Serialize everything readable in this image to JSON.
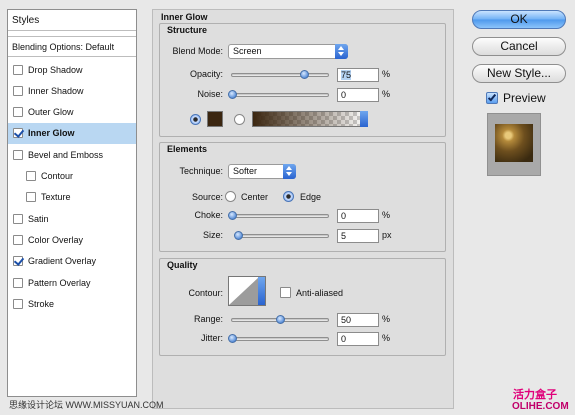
{
  "styles_list": {
    "header": "Styles",
    "blending_options": "Blending Options: Default",
    "items": [
      {
        "label": "Drop Shadow",
        "checked": false,
        "indent": false,
        "selected": false
      },
      {
        "label": "Inner Shadow",
        "checked": false,
        "indent": false,
        "selected": false
      },
      {
        "label": "Outer Glow",
        "checked": false,
        "indent": false,
        "selected": false
      },
      {
        "label": "Inner Glow",
        "checked": true,
        "indent": false,
        "selected": true
      },
      {
        "label": "Bevel and Emboss",
        "checked": false,
        "indent": false,
        "selected": false
      },
      {
        "label": "Contour",
        "checked": false,
        "indent": true,
        "selected": false
      },
      {
        "label": "Texture",
        "checked": false,
        "indent": true,
        "selected": false
      },
      {
        "label": "Satin",
        "checked": false,
        "indent": false,
        "selected": false
      },
      {
        "label": "Color Overlay",
        "checked": false,
        "indent": false,
        "selected": false
      },
      {
        "label": "Gradient Overlay",
        "checked": true,
        "indent": false,
        "selected": false
      },
      {
        "label": "Pattern Overlay",
        "checked": false,
        "indent": false,
        "selected": false
      },
      {
        "label": "Stroke",
        "checked": false,
        "indent": false,
        "selected": false
      }
    ]
  },
  "panel": {
    "title": "Inner Glow",
    "structure": {
      "title": "Structure",
      "blend_mode_label": "Blend Mode:",
      "blend_mode_value": "Screen",
      "opacity_label": "Opacity:",
      "opacity_value": "75",
      "opacity_level": 0.75,
      "noise_label": "Noise:",
      "noise_value": "0",
      "noise_level": 0.0,
      "percent": "%",
      "glow_color": "#3b2610"
    },
    "elements": {
      "title": "Elements",
      "technique_label": "Technique:",
      "technique_value": "Softer",
      "source_label": "Source:",
      "source_center": "Center",
      "source_edge": "Edge",
      "choke_label": "Choke:",
      "choke_value": "0",
      "choke_level": 0.0,
      "size_label": "Size:",
      "size_value": "5",
      "size_level": 0.02,
      "percent": "%",
      "px": "px"
    },
    "quality": {
      "title": "Quality",
      "contour_label": "Contour:",
      "anti_aliased_label": "Anti-aliased",
      "range_label": "Range:",
      "range_value": "50",
      "range_level": 0.5,
      "jitter_label": "Jitter:",
      "jitter_value": "0",
      "jitter_level": 0.0,
      "percent": "%"
    }
  },
  "buttons": {
    "ok": "OK",
    "cancel": "Cancel",
    "new_style": "New Style...",
    "preview_label": "Preview"
  },
  "watermarks": {
    "left": "思缘设计论坛 WWW.MISSYUAN.COM",
    "right_top": "活力盒子",
    "right_bottom": "OLIHE.COM"
  },
  "colors": {
    "accent": "#4d98ec",
    "selection": "#b9d7f2",
    "watermark_red": "#e0007a"
  }
}
